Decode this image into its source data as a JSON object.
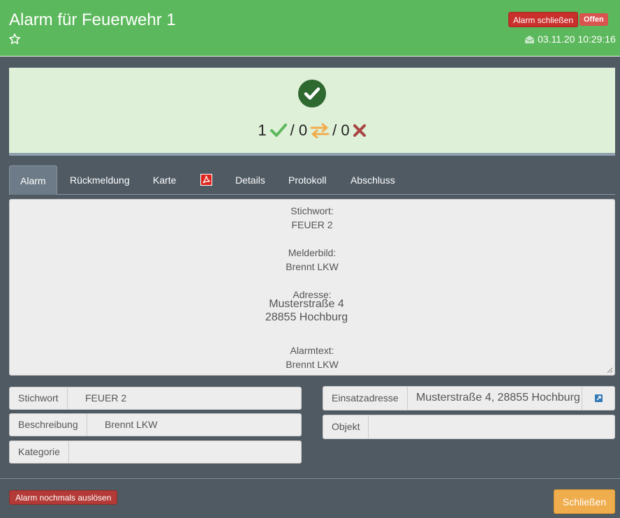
{
  "header": {
    "title": "Alarm für Feuerwehr 1",
    "close_alarm_label": "Alarm schließen",
    "status_badge": "Offen",
    "timestamp": "03.11.20 10:29:16"
  },
  "status": {
    "accepted_count": "1",
    "separator1": "/ 0",
    "separator2": "/ 0",
    "colors": {
      "ok": "#5cb85c",
      "transfer": "#f0ad4e",
      "reject": "#a94442"
    }
  },
  "tabs": [
    {
      "label": "Alarm"
    },
    {
      "label": "Rückmeldung"
    },
    {
      "label": "Karte"
    },
    {
      "label": "Details"
    },
    {
      "label": "Protokoll"
    },
    {
      "label": "Abschluss"
    }
  ],
  "alarm_text": {
    "stichwort_label": "Stichwort:",
    "stichwort_value": "FEUER 2",
    "melderbild_label": "Melderbild:",
    "melderbild_value": "Brennt LKW",
    "adresse_label": "Adresse:",
    "adresse_line1": "Musterstraße 4",
    "adresse_line2": "28855 Hochburg",
    "alarmtext_label": "Alarmtext:",
    "alarmtext_value": "Brennt LKW"
  },
  "fields": {
    "stichwort": {
      "label": "Stichwort",
      "value": "FEUER 2"
    },
    "beschreibung": {
      "label": "Beschreibung",
      "value": "Brennt LKW"
    },
    "kategorie": {
      "label": "Kategorie",
      "value": ""
    },
    "einsatzadresse": {
      "label": "Einsatzadresse",
      "value": "Musterstraße 4, 28855 Hochburg"
    },
    "objekt": {
      "label": "Objekt",
      "value": ""
    }
  },
  "footer": {
    "retrigger_label": "Alarm nochmals auslösen",
    "close_label": "Schließen"
  }
}
